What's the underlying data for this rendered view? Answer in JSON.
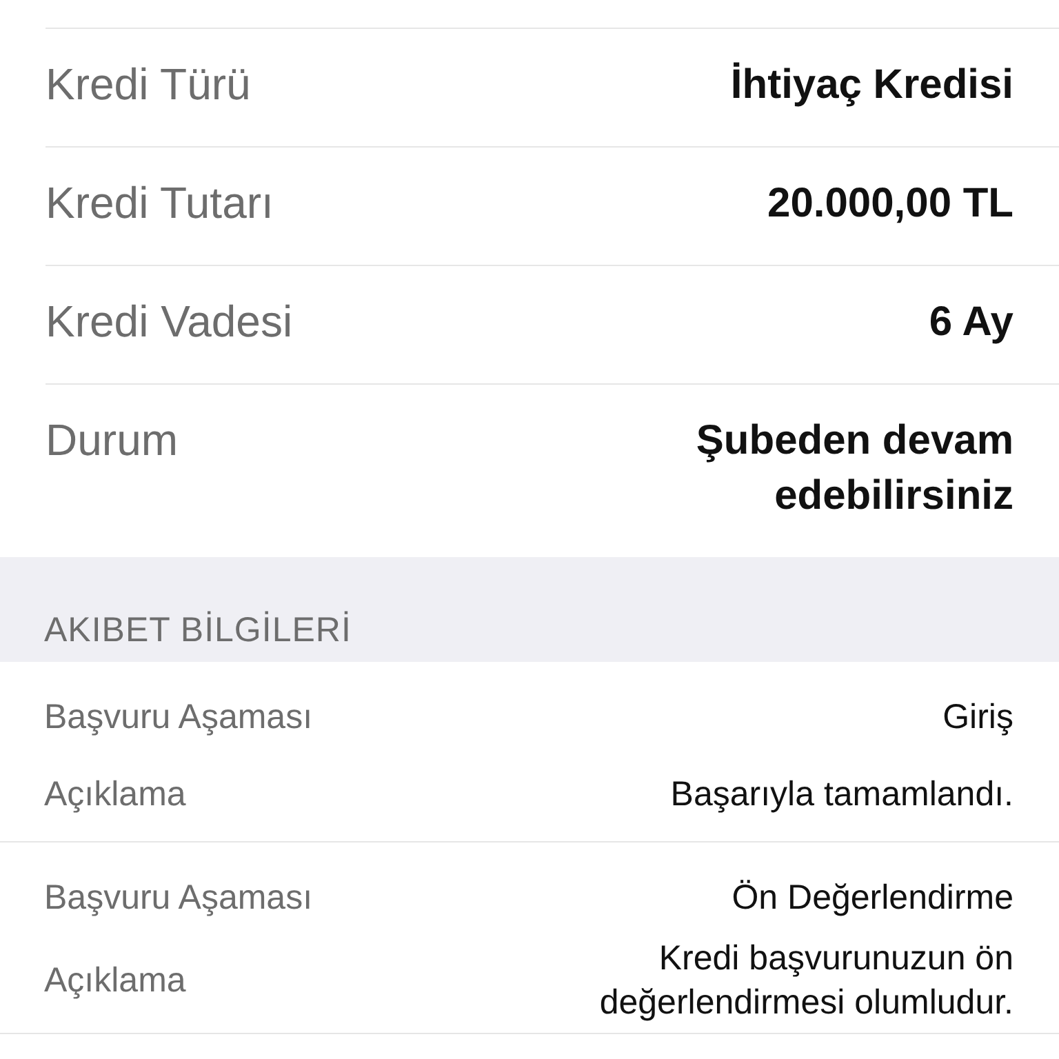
{
  "details": [
    {
      "label": "Kredi Türü",
      "value": "İhtiyaç Kredisi"
    },
    {
      "label": "Kredi Tutarı",
      "value": "20.000,00 TL"
    },
    {
      "label": "Kredi Vadesi",
      "value": "6 Ay"
    },
    {
      "label": "Durum",
      "value": "Şubeden devam edebilirsiniz"
    }
  ],
  "section_header": "AKIBET BİLGİLERİ",
  "stages": [
    {
      "stage_label": "Başvuru Aşaması",
      "stage": "Giriş",
      "note_label": "Açıklama",
      "note": "Başarıyla tamamlandı."
    },
    {
      "stage_label": "Başvuru Aşaması",
      "stage": "Ön Değerlendirme",
      "note_label": "Açıklama",
      "note": "Kredi başvurunuzun ön değerlendirmesi olumludur."
    }
  ]
}
